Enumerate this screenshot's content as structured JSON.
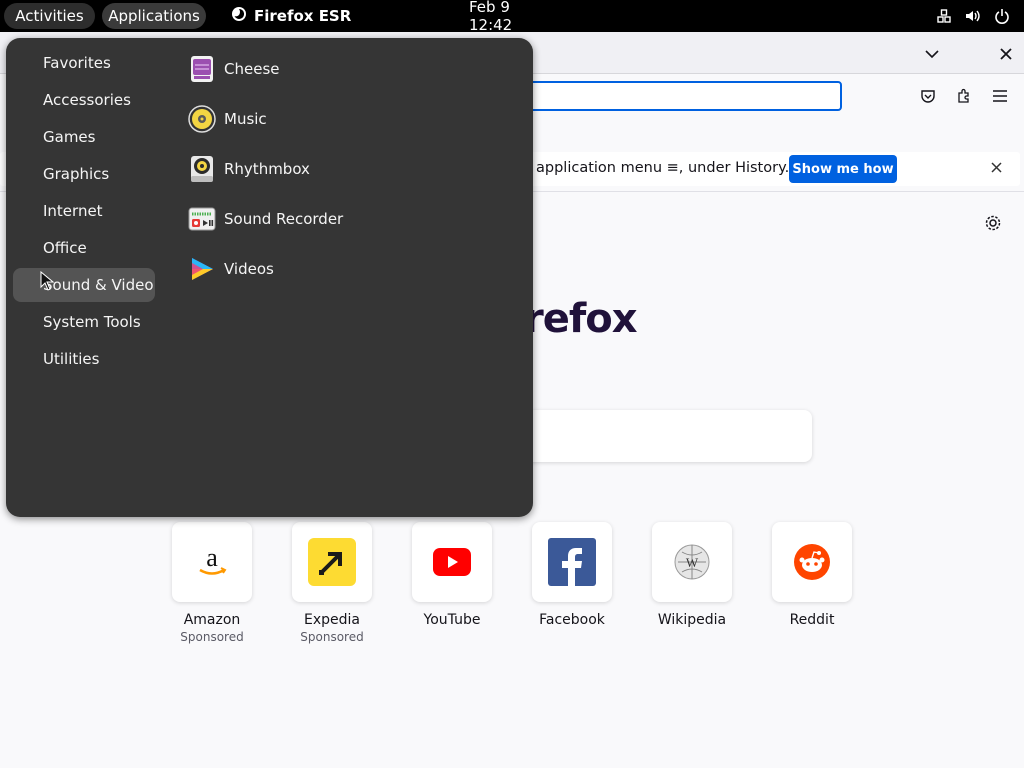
{
  "topbar": {
    "activities": "Activities",
    "applications": "Applications",
    "app_name": "Firefox ESR",
    "clock": "Feb 9  12:42"
  },
  "firefox": {
    "notice_text": "application menu ≡, under History.",
    "notice_button": "Show me how",
    "logo_text": "refox",
    "close_glyph": "✕",
    "chevron_glyph": "⌄"
  },
  "top_sites": [
    {
      "name": "Amazon",
      "sub": "Sponsored"
    },
    {
      "name": "Expedia",
      "sub": "Sponsored"
    },
    {
      "name": "YouTube",
      "sub": ""
    },
    {
      "name": "Facebook",
      "sub": ""
    },
    {
      "name": "Wikipedia",
      "sub": ""
    },
    {
      "name": "Reddit",
      "sub": ""
    }
  ],
  "menu": {
    "categories": [
      "Favorites",
      "Accessories",
      "Games",
      "Graphics",
      "Internet",
      "Office",
      "Sound & Video",
      "System Tools",
      "Utilities"
    ],
    "selected_category": "Sound & Video",
    "apps": [
      {
        "label": "Cheese",
        "icon": "cheese-icon"
      },
      {
        "label": "Music",
        "icon": "music-icon"
      },
      {
        "label": "Rhythmbox",
        "icon": "rhythmbox-icon"
      },
      {
        "label": "Sound Recorder",
        "icon": "sound-recorder-icon"
      },
      {
        "label": "Videos",
        "icon": "videos-icon"
      }
    ]
  },
  "colors": {
    "accent": "#0061e0",
    "menu_bg": "#353535",
    "menu_selected": "#545454"
  }
}
